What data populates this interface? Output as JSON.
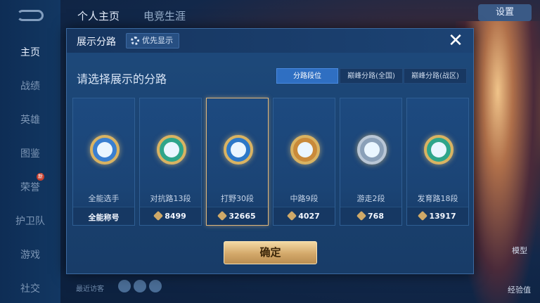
{
  "sidebar": {
    "items": [
      {
        "label": "主页",
        "active": true
      },
      {
        "label": "战绩"
      },
      {
        "label": "英雄"
      },
      {
        "label": "图鉴"
      },
      {
        "label": "荣誉"
      },
      {
        "label": "护卫队"
      },
      {
        "label": "游戏"
      },
      {
        "label": "社交"
      }
    ],
    "badge_text": "新"
  },
  "top_tabs": {
    "tab1": "个人主页",
    "tab2": "电竞生涯"
  },
  "top_right_button": "设置",
  "right_labels": {
    "mode": "模型",
    "bottom": "经验值"
  },
  "bottom": {
    "visitor_text": "最近访客"
  },
  "modal": {
    "title": "展示分路",
    "priority_button": "优先显示",
    "subtitle": "请选择展示的分路",
    "segments": [
      {
        "label": "分路段位",
        "active": true
      },
      {
        "label": "巅峰分路(全国)",
        "active": false
      },
      {
        "label": "巅峰分路(战区)",
        "active": false
      }
    ],
    "cards": [
      {
        "label": "全能选手",
        "footer": "全能称号",
        "has_icon": false,
        "color": "#3a7fd0"
      },
      {
        "label": "对抗路13段",
        "footer": "8499",
        "has_icon": true,
        "color": "#2ea58a"
      },
      {
        "label": "打野30段",
        "footer": "32665",
        "has_icon": true,
        "color": "#2c78c8",
        "selected": true
      },
      {
        "label": "中路9段",
        "footer": "4027",
        "has_icon": true,
        "color": "#c98a3a"
      },
      {
        "label": "游走2段",
        "footer": "768",
        "has_icon": true,
        "color": "#8aa0b8"
      },
      {
        "label": "发育路18段",
        "footer": "13917",
        "has_icon": true,
        "color": "#2ea58a"
      }
    ],
    "confirm_button": "确定"
  },
  "colors": {
    "accent_gold": "#d3a86a",
    "segment_active": "#2f6fc2",
    "modal_bg": "#1e4a7c"
  }
}
